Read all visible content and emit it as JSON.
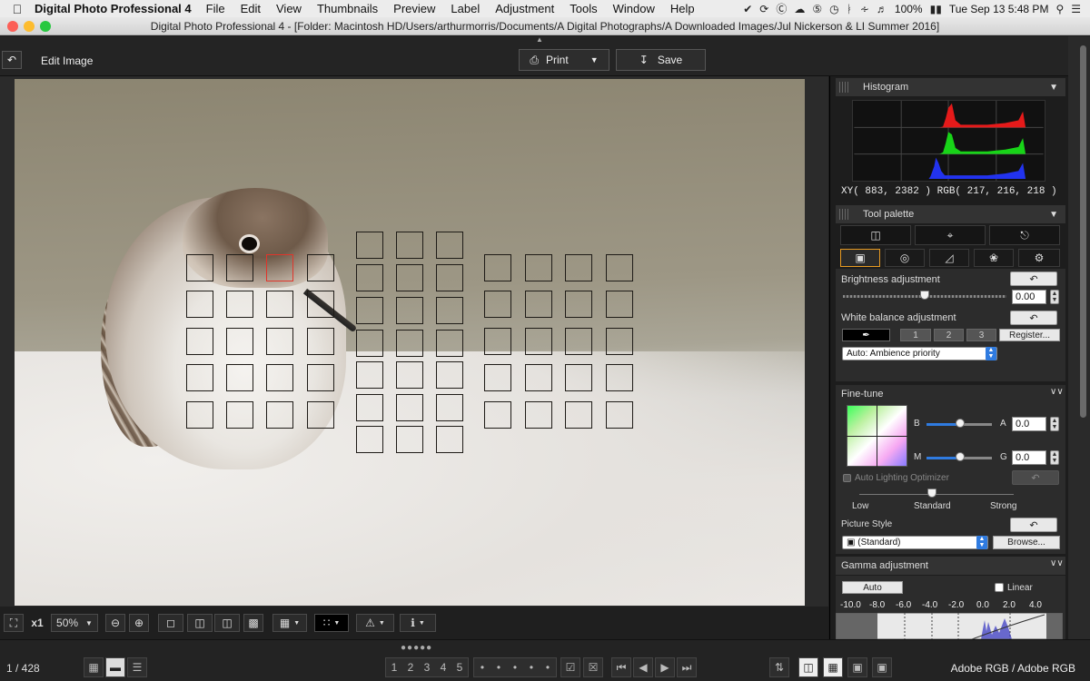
{
  "menubar": {
    "app_name": "Digital Photo Professional 4",
    "menus": [
      "File",
      "Edit",
      "View",
      "Thumbnails",
      "Preview",
      "Label",
      "Adjustment",
      "Tools",
      "Window",
      "Help"
    ],
    "battery": "100%",
    "clock": "Tue Sep 13  5:48 PM"
  },
  "window": {
    "title": "Digital Photo Professional 4 - [Folder: Macintosh HD/Users/arthurmorris/Documents/A Digital Photographs/A Downloaded Images/Jul Nickerson & LI Summer 2016]"
  },
  "toolbar": {
    "mode_label": "Edit Image",
    "print_label": "Print",
    "save_label": "Save"
  },
  "viewer": {
    "zoom_x1": "x1",
    "zoom_percent": "50%"
  },
  "status": {
    "count": "1 / 428",
    "color_space": "Adobe RGB / Adobe RGB",
    "star_labels": [
      "1",
      "2",
      "3",
      "4",
      "5"
    ]
  },
  "histogram": {
    "title": "Histogram",
    "readout": "XY(   883,  2382 ) RGB( 217, 216, 218 )",
    "colors": {
      "red": "#e51a1a",
      "green": "#18d418",
      "blue": "#2233ee"
    }
  },
  "tool_palette": {
    "title": "Tool palette",
    "brightness": {
      "label": "Brightness adjustment",
      "value": "0.00"
    },
    "white_balance": {
      "label": "White balance adjustment",
      "presets": [
        "1",
        "2",
        "3"
      ],
      "register_label": "Register...",
      "mode": "Auto: Ambience priority"
    }
  },
  "fine_tune": {
    "title": "Fine-tune",
    "b_label": "B",
    "a_label": "A",
    "a_value": "0.0",
    "m_label": "M",
    "g_label": "G",
    "g_value": "0.0",
    "alo_label": "Auto Lighting Optimizer",
    "alo_levels": [
      "Low",
      "Standard",
      "Strong"
    ],
    "picture_style_label": "Picture Style",
    "picture_style_value": "(Standard)",
    "browse_label": "Browse..."
  },
  "gamma": {
    "title": "Gamma adjustment",
    "auto_label": "Auto",
    "linear_label": "Linear",
    "ticks": [
      "-10.0",
      "-8.0",
      "-6.0",
      "-4.0",
      "-2.0",
      "0.0",
      "2.0",
      "4.0"
    ]
  },
  "accent_color": "#e79a22"
}
